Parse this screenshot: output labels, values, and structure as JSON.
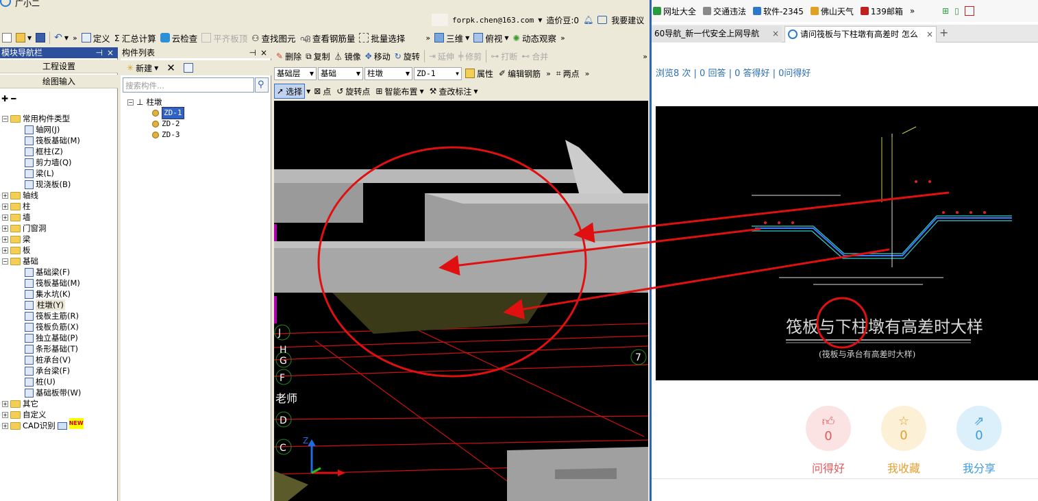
{
  "app": {
    "title": "广小二",
    "account": "forpk.chen@163.com",
    "price_beans": "造价豆:0",
    "feedback": "我要建议"
  },
  "menu_toolbar": {
    "define": "定义",
    "calc": "汇总计算",
    "cloud_check": "云检查",
    "level_slab": "平齐板顶",
    "find_element": "查找图元",
    "view_rebar": "查看钢筋量",
    "batch_select": "批量选择",
    "view_3d": "三维",
    "top_view": "俯视",
    "dynamic_view": "动态观察"
  },
  "nav_panel": {
    "title": "模块导航栏",
    "tab_project": "工程设置",
    "tab_draw": "绘图输入",
    "tree": [
      {
        "label": "常用构件类型",
        "kind": "folder",
        "expanded": true
      },
      {
        "label": "轴网(J)",
        "kind": "leaf"
      },
      {
        "label": "筏板基础(M)",
        "kind": "leaf"
      },
      {
        "label": "框柱(Z)",
        "kind": "leaf"
      },
      {
        "label": "剪力墙(Q)",
        "kind": "leaf"
      },
      {
        "label": "梁(L)",
        "kind": "leaf"
      },
      {
        "label": "现浇板(B)",
        "kind": "leaf"
      },
      {
        "label": "轴线",
        "kind": "folder",
        "expanded": false
      },
      {
        "label": "柱",
        "kind": "folder",
        "expanded": false
      },
      {
        "label": "墙",
        "kind": "folder",
        "expanded": false
      },
      {
        "label": "门窗洞",
        "kind": "folder",
        "expanded": false
      },
      {
        "label": "梁",
        "kind": "folder",
        "expanded": false
      },
      {
        "label": "板",
        "kind": "folder",
        "expanded": false
      },
      {
        "label": "基础",
        "kind": "folder",
        "expanded": true
      },
      {
        "label": "基础梁(F)",
        "kind": "leaf"
      },
      {
        "label": "筏板基础(M)",
        "kind": "leaf"
      },
      {
        "label": "集水坑(K)",
        "kind": "leaf"
      },
      {
        "label": "柱墩(Y)",
        "kind": "leaf",
        "selected": true
      },
      {
        "label": "筏板主筋(R)",
        "kind": "leaf"
      },
      {
        "label": "筏板负筋(X)",
        "kind": "leaf"
      },
      {
        "label": "独立基础(P)",
        "kind": "leaf"
      },
      {
        "label": "条形基础(T)",
        "kind": "leaf"
      },
      {
        "label": "桩承台(V)",
        "kind": "leaf"
      },
      {
        "label": "承台梁(F)",
        "kind": "leaf"
      },
      {
        "label": "桩(U)",
        "kind": "leaf"
      },
      {
        "label": "基础板带(W)",
        "kind": "leaf"
      },
      {
        "label": "其它",
        "kind": "folder",
        "expanded": false
      },
      {
        "label": "自定义",
        "kind": "folder",
        "expanded": false
      },
      {
        "label": "CAD识别",
        "kind": "folder",
        "expanded": false,
        "badge": "NEW"
      }
    ]
  },
  "component_list": {
    "title": "构件列表",
    "new_label": "新建",
    "search_placeholder": "搜索构件...",
    "root": "柱墩",
    "items": [
      "ZD-1",
      "ZD-2",
      "ZD-3"
    ]
  },
  "draw_toolbar1": {
    "delete": "删除",
    "copy": "复制",
    "mirror": "镜像",
    "move": "移动",
    "rotate": "旋转",
    "extend": "延伸",
    "trim": "修剪",
    "break": "打断",
    "merge": "合并"
  },
  "draw_toolbar2": {
    "layer_label": "基础层",
    "category": "基础",
    "type": "柱墩",
    "component": "ZD-1",
    "properties": "属性",
    "edit_rebar": "编辑钢筋",
    "two_points": "两点"
  },
  "draw_toolbar3": {
    "select": "选择",
    "point": "点",
    "rotate_point": "旋转点",
    "smart_layout": "智能布置",
    "modify_label": "查改标注"
  },
  "viewport": {
    "axis_labels": [
      "J",
      "H",
      "G",
      "F",
      "D",
      "C"
    ],
    "axis_number": "7",
    "watermark": "老师",
    "axis_z": "Z"
  },
  "browser": {
    "bookmarks": [
      "网址大全",
      "交通违法",
      "软件-2345",
      "佛山天气",
      "139邮箱"
    ],
    "tab1_title": "60导航_新一代安全上网导航",
    "tab2_title": "请问筏板与下柱墩有高差时 怎么",
    "stats": "浏览8 次 | 0 回答 | 0 答得好 | 0问得好",
    "cad_caption": "筏板与下柱墩有高差时大样",
    "cad_subcaption": "(筏板与承台有高差时大样)",
    "actions": [
      {
        "count": "0",
        "label": "问得好",
        "color": "#e05a5a",
        "bg": "#fbe3e3"
      },
      {
        "count": "0",
        "label": "我收藏",
        "color": "#e0a030",
        "bg": "#fcf0d6"
      },
      {
        "count": "0",
        "label": "我分享",
        "color": "#3b9ae0",
        "bg": "#dcf0fb"
      }
    ]
  }
}
